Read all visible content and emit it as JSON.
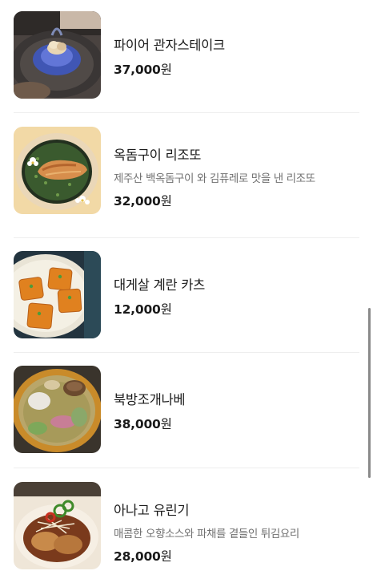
{
  "menu": {
    "items": [
      {
        "name": "파이어 관자스테이크",
        "description": "",
        "price": "37,000",
        "currency": "원",
        "image_alt": "fire-scallop-steak-photo"
      },
      {
        "name": "옥돔구이 리조또",
        "description": "제주산 백옥돔구이 와 김퓨레로 맛을 낸 리조또",
        "price": "32,000",
        "currency": "원",
        "image_alt": "grilled-tilefish-risotto-photo"
      },
      {
        "name": "대게살 계란 카츠",
        "description": "",
        "price": "12,000",
        "currency": "원",
        "image_alt": "crab-egg-katsu-photo"
      },
      {
        "name": "북방조개나베",
        "description": "",
        "price": "38,000",
        "currency": "원",
        "image_alt": "surf-clam-nabe-photo"
      },
      {
        "name": "아나고 유린기",
        "description": "매콤한 오향소스와 파채를 곁들인 튀김요리",
        "price": "28,000",
        "currency": "원",
        "image_alt": "anago-yuringi-photo"
      }
    ]
  },
  "colors": {
    "text_primary": "#1a1a1a",
    "text_secondary": "#707070",
    "divider": "#eeeeee",
    "scrollbar": "#8a8a8a"
  }
}
